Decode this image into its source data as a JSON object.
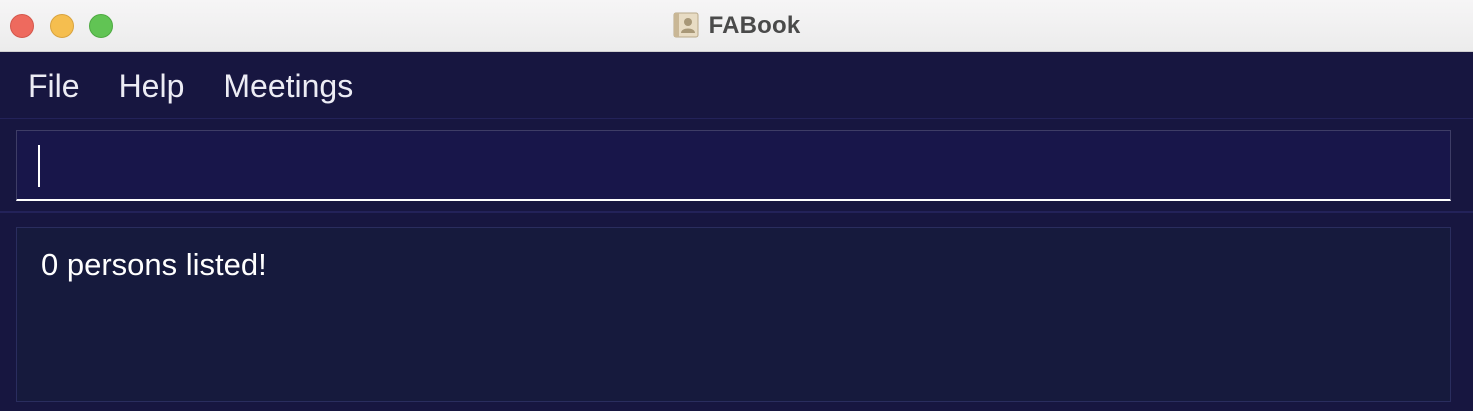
{
  "window": {
    "title": "FABook",
    "icon": "address-book-icon"
  },
  "menu": {
    "items": [
      {
        "label": "File"
      },
      {
        "label": "Help"
      },
      {
        "label": "Meetings"
      }
    ]
  },
  "command_box": {
    "value": "",
    "placeholder": ""
  },
  "result_display": {
    "message": "0 persons listed!"
  },
  "colors": {
    "background": "#171640",
    "result_panel": "#161a3d",
    "text": "#ffffff",
    "close": "#ee6a5e",
    "minimize": "#f5be4f",
    "zoom": "#61c454"
  }
}
